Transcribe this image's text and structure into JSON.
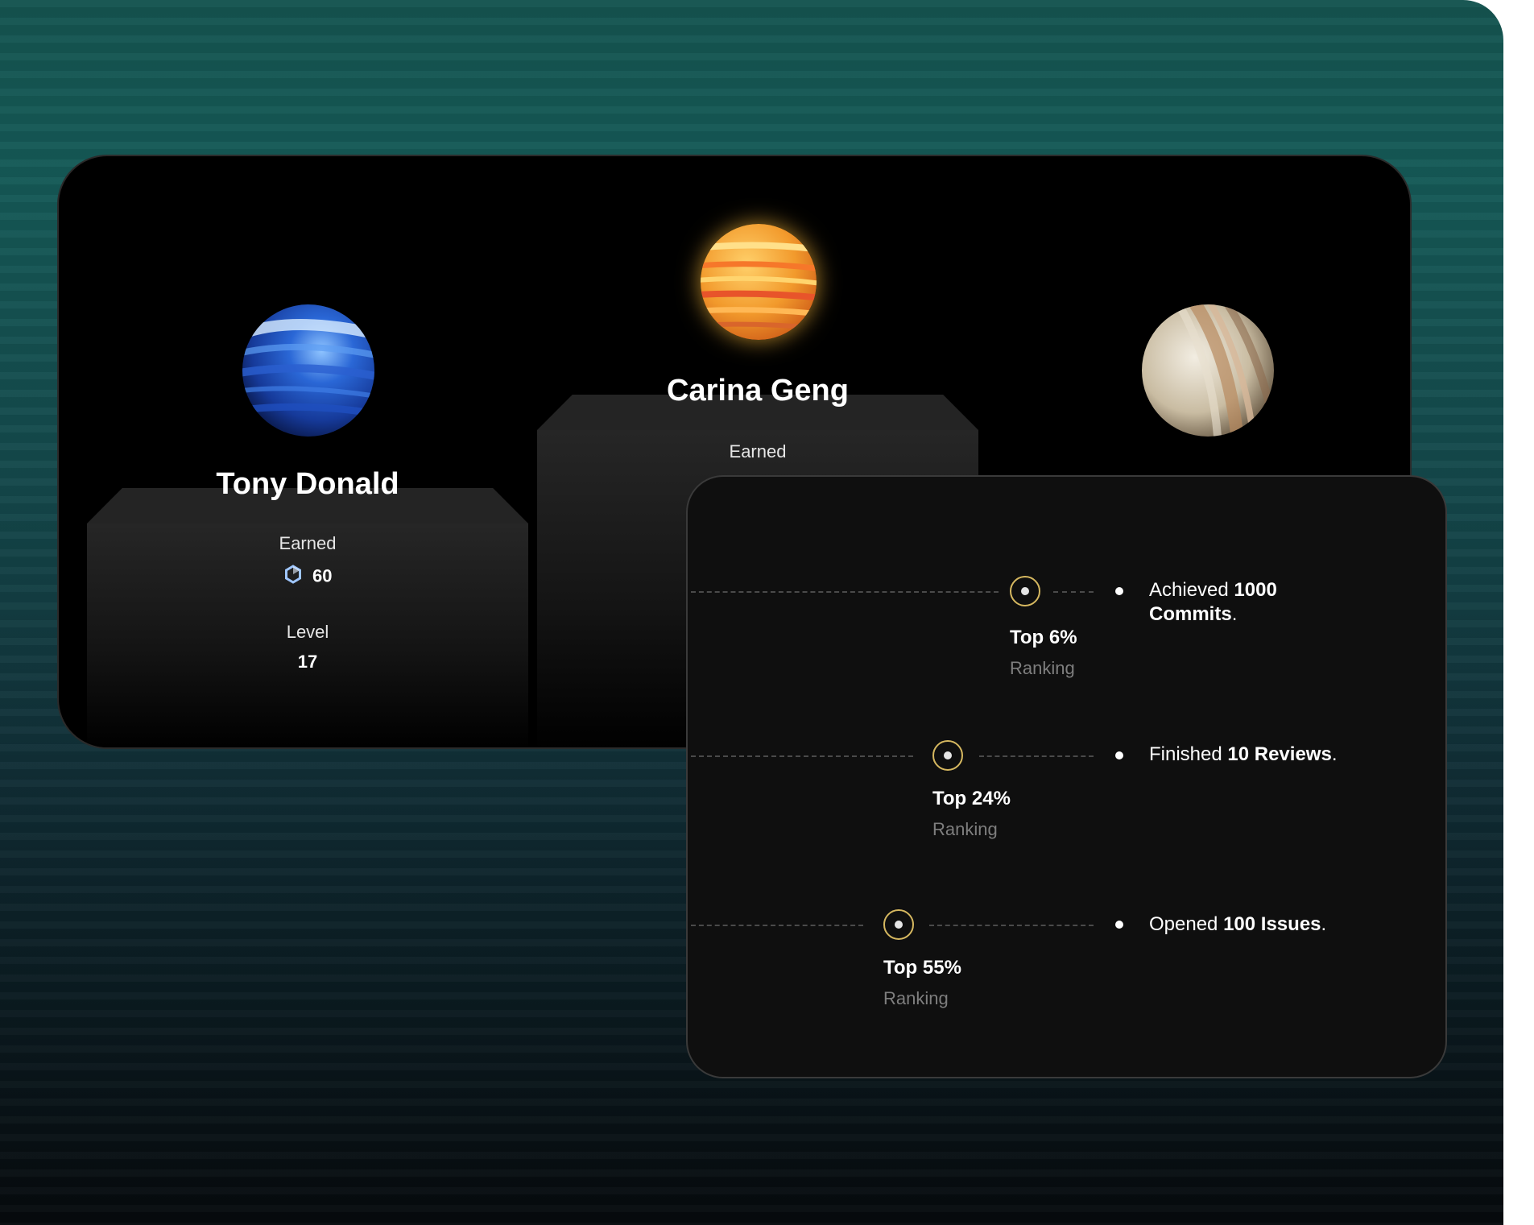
{
  "podium": {
    "players": [
      {
        "name": "Tony Donald",
        "earned_label": "Earned",
        "earned_value": "60",
        "level_label": "Level",
        "level_value": "17"
      },
      {
        "name": "Carina Geng",
        "earned_label": "Earned"
      },
      {
        "name": ""
      }
    ]
  },
  "achievements": [
    {
      "rank": "Top 6%",
      "rank_label": "Ranking",
      "text_prefix": "Achieved",
      "text_bold": "1000 Commits",
      "text_suffix": "."
    },
    {
      "rank": "Top 24%",
      "rank_label": "Ranking",
      "text_prefix": "Finished",
      "text_bold": "10 Reviews",
      "text_suffix": "."
    },
    {
      "rank": "Top 55%",
      "rank_label": "Ranking",
      "text_prefix": "Opened",
      "text_bold": "100 Issues",
      "text_suffix": "."
    }
  ],
  "colors": {
    "background_top": "#155450",
    "background_bottom": "#060a0d",
    "ring_accent": "#d6b860",
    "muted_text": "#7e7e7e"
  },
  "icons": {
    "earned": "token-hexagon-icon",
    "ranking": "ring-dot-icon",
    "achievement": "bullet-dot-icon"
  }
}
